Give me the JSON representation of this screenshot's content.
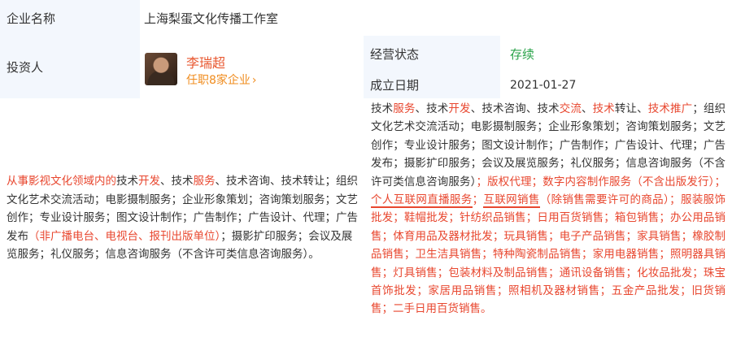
{
  "company": {
    "name_label": "企业名称",
    "name": "上海梨蛋文化传播工作室"
  },
  "investor": {
    "label": "投资人",
    "name": "李瑞超",
    "roles_link": "任职8家企业",
    "chevron": "›"
  },
  "status": {
    "label": "经营状态",
    "value": "存续",
    "value_color": "#2aa34a"
  },
  "established": {
    "label": "成立日期",
    "value": "2021-01-27"
  },
  "scope_left": [
    {
      "t": "从事影视文化领域内的",
      "hl": true
    },
    {
      "t": "技术",
      "hl": false
    },
    {
      "t": "开发",
      "hl": true
    },
    {
      "t": "、技术",
      "hl": false
    },
    {
      "t": "服务",
      "hl": true
    },
    {
      "t": "、技术咨询、技术转让；组织文化艺术交流活动；电影摄制服务；企业形象策划；咨询策划服务；文艺创作；专业设计服务；图文设计制作；广告制作；广告设计、代理；广告发布",
      "hl": false
    },
    {
      "t": "（非广播电台、电视台、报刊出版单位）",
      "hl": true
    },
    {
      "t": "；摄影扩印服务；会议及展览服务；礼仪服务；信息咨询服务（不含许可类信息咨询服务）。",
      "hl": false
    }
  ],
  "scope_right": [
    {
      "t": "技术",
      "hl": false
    },
    {
      "t": "服务",
      "hl": true
    },
    {
      "t": "、技术",
      "hl": false
    },
    {
      "t": "开发",
      "hl": true
    },
    {
      "t": "、技术咨询、技术",
      "hl": false
    },
    {
      "t": "交流",
      "hl": true
    },
    {
      "t": "、",
      "hl": false
    },
    {
      "t": "技术",
      "hl": true
    },
    {
      "t": "转让、",
      "hl": false
    },
    {
      "t": "技术推广",
      "hl": true
    },
    {
      "t": "；组织文化艺术交流活动；电影摄制服务；企业形象策划；咨询策划服务；文艺创作；专业设计服务；图文设计制作；广告制作；广告设计、代理；广告发布；摄影扩印服务；会议及展览服务；礼仪服务；信息咨询服务（不含许可类信息咨询服务）",
      "hl": false
    },
    {
      "t": "；版权代理；数字内容制作服务（不含出版发行）；",
      "hl": true
    },
    {
      "t": "个人互联网直播服务",
      "hl": true,
      "underline": true
    },
    {
      "t": "；",
      "hl": true
    },
    {
      "t": "互联网销售",
      "hl": true,
      "underline": true
    },
    {
      "t": "（除销售需要许可的商品）；服装服饰批发；鞋帽批发；针纺织品销售；日用百货销售；箱包销售；办公用品销售；体育用品及器材批发；玩具销售；电子产品销售；家具销售；橡胶制品销售；卫生洁具销售；特种陶瓷制品销售；家用电器销售；照明器具销售；灯具销售；包装材料及制品销售；通讯设备销售；化妆品批发；珠宝首饰批发；家居用品销售；照相机及器材销售；五金产品批发；旧货销售；二手日用百货销售。",
      "hl": true
    }
  ],
  "colors": {
    "label_bg": "#f3f7fd",
    "highlight": "#e8472f",
    "investor_name": "#e8572f",
    "roles_link": "#f08c1e"
  }
}
